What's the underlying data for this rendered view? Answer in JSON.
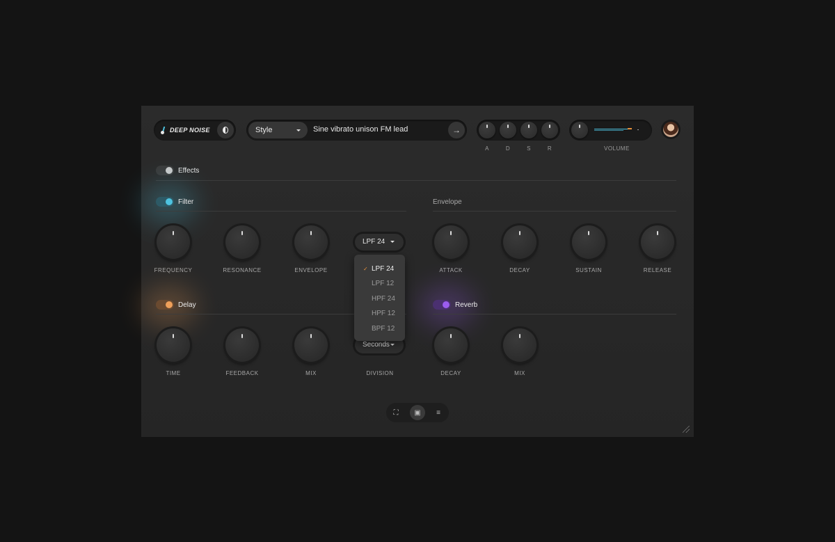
{
  "brand": {
    "name": "DEEP NOISE"
  },
  "prompt": {
    "style_label": "Style",
    "text": "Sine vibrato unison FM lead"
  },
  "adsr": {
    "labels": [
      "A",
      "D",
      "S",
      "R"
    ]
  },
  "volume": {
    "label": "VOLUME"
  },
  "sections": {
    "effects": {
      "label": "Effects",
      "enabled": false,
      "color": "#c8c8c8"
    },
    "filter": {
      "label": "Filter",
      "enabled": true,
      "color": "#4ec3e0",
      "knobs": [
        "FREQUENCY",
        "RESONANCE",
        "ENVELOPE"
      ],
      "type_value": "LPF 24"
    },
    "envelope": {
      "label": "Envelope",
      "knobs": [
        "ATTACK",
        "DECAY",
        "SUSTAIN",
        "RELEASE"
      ]
    },
    "delay": {
      "label": "Delay",
      "enabled": true,
      "color": "#f0a05a",
      "knobs": [
        "TIME",
        "FEEDBACK",
        "MIX"
      ],
      "division_value": "Seconds",
      "division_label": "DIVISION"
    },
    "reverb": {
      "label": "Reverb",
      "enabled": true,
      "color": "#9b5cf0",
      "knobs": [
        "DECAY",
        "MIX"
      ]
    }
  },
  "filter_dropdown": {
    "selected": "LPF 24",
    "options": [
      "LPF 24",
      "LPF 12",
      "HPF 24",
      "HPF 12",
      "BPF 12"
    ]
  },
  "accent_color": "#e8913c"
}
